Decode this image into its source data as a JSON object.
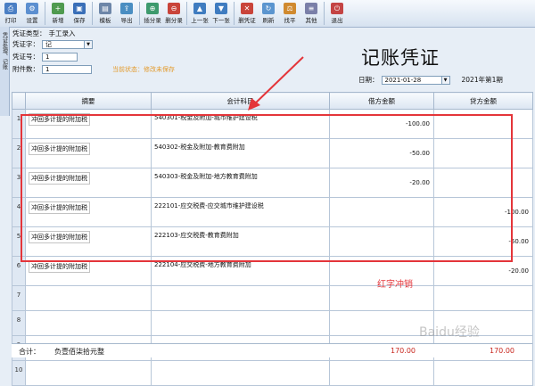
{
  "toolbar": {
    "buttons": [
      {
        "label": "打印",
        "color": "#4b7fc4"
      },
      {
        "label": "设置",
        "color": "#5c8fd0"
      },
      {
        "label": "新增",
        "color": "#4f9a4f"
      },
      {
        "label": "保存",
        "color": "#3a6fb8"
      },
      {
        "label": "模板",
        "color": "#6d86a8"
      },
      {
        "label": "导出",
        "color": "#4a8ec2"
      },
      {
        "label": "插分录",
        "color": "#3d9a6d"
      },
      {
        "label": "删分录",
        "color": "#c9443a"
      },
      {
        "label": "上一张",
        "color": "#3f7cc0"
      },
      {
        "label": "下一张",
        "color": "#3f7cc0"
      },
      {
        "label": "删凭证",
        "color": "#c9443a"
      },
      {
        "label": "刷新",
        "color": "#5b95cf"
      },
      {
        "label": "找平",
        "color": "#d08a2f"
      },
      {
        "label": "其他",
        "color": "#7a7fa8"
      },
      {
        "label": "退出",
        "color": "#c44444"
      }
    ]
  },
  "sidetab": {
    "label": "凭证处理、记账"
  },
  "form": {
    "voucher_type_label": "凭证类型：",
    "voucher_type_value": "手工录入",
    "voucher_word_label": "凭证字：",
    "voucher_word_value": "记",
    "voucher_no_label": "凭证号：",
    "voucher_no_value": "1",
    "attachments_label": "附件数：",
    "attachments_value": "1",
    "status_text": "当前状态：修改未保存"
  },
  "title": "记账凭证",
  "date": {
    "label": "日期：",
    "value": "2021-01-28",
    "period": "2021年第1期"
  },
  "table": {
    "headers": [
      "摘要",
      "会计科目",
      "借方金额",
      "贷方金额"
    ],
    "rows": [
      {
        "num": "1",
        "summary": "冲回多计提的附加税",
        "account": "540301-税金及附加-城市维护建设税",
        "debit": "-100.00",
        "credit": ""
      },
      {
        "num": "2",
        "summary": "冲回多计提的附加税",
        "account": "540302-税金及附加-教育费附加",
        "debit": "-50.00",
        "credit": ""
      },
      {
        "num": "3",
        "summary": "冲回多计提的附加税",
        "account": "540303-税金及附加-地方教育费附加",
        "debit": "-20.00",
        "credit": ""
      },
      {
        "num": "4",
        "summary": "冲回多计提的附加税",
        "account": "222101-应交税费-应交城市维护建设税",
        "debit": "",
        "credit": "-100.00"
      },
      {
        "num": "5",
        "summary": "冲回多计提的附加税",
        "account": "222103-应交税费-教育费附加",
        "debit": "",
        "credit": "-50.00"
      },
      {
        "num": "6",
        "summary": "冲回多计提的附加税",
        "account": "222104-应交税费-地方教育费附加",
        "debit": "",
        "credit": "-20.00"
      }
    ],
    "blank_rows": [
      "7",
      "8",
      "9",
      "10"
    ]
  },
  "footer": {
    "label": "合计：",
    "amount_words": "负壹佰柒拾元整",
    "debit_total": "170.00",
    "credit_total": "170.00"
  },
  "annotation": {
    "label": "红字冲销",
    "color": "#e4353a"
  },
  "watermark": "Baidu经验"
}
